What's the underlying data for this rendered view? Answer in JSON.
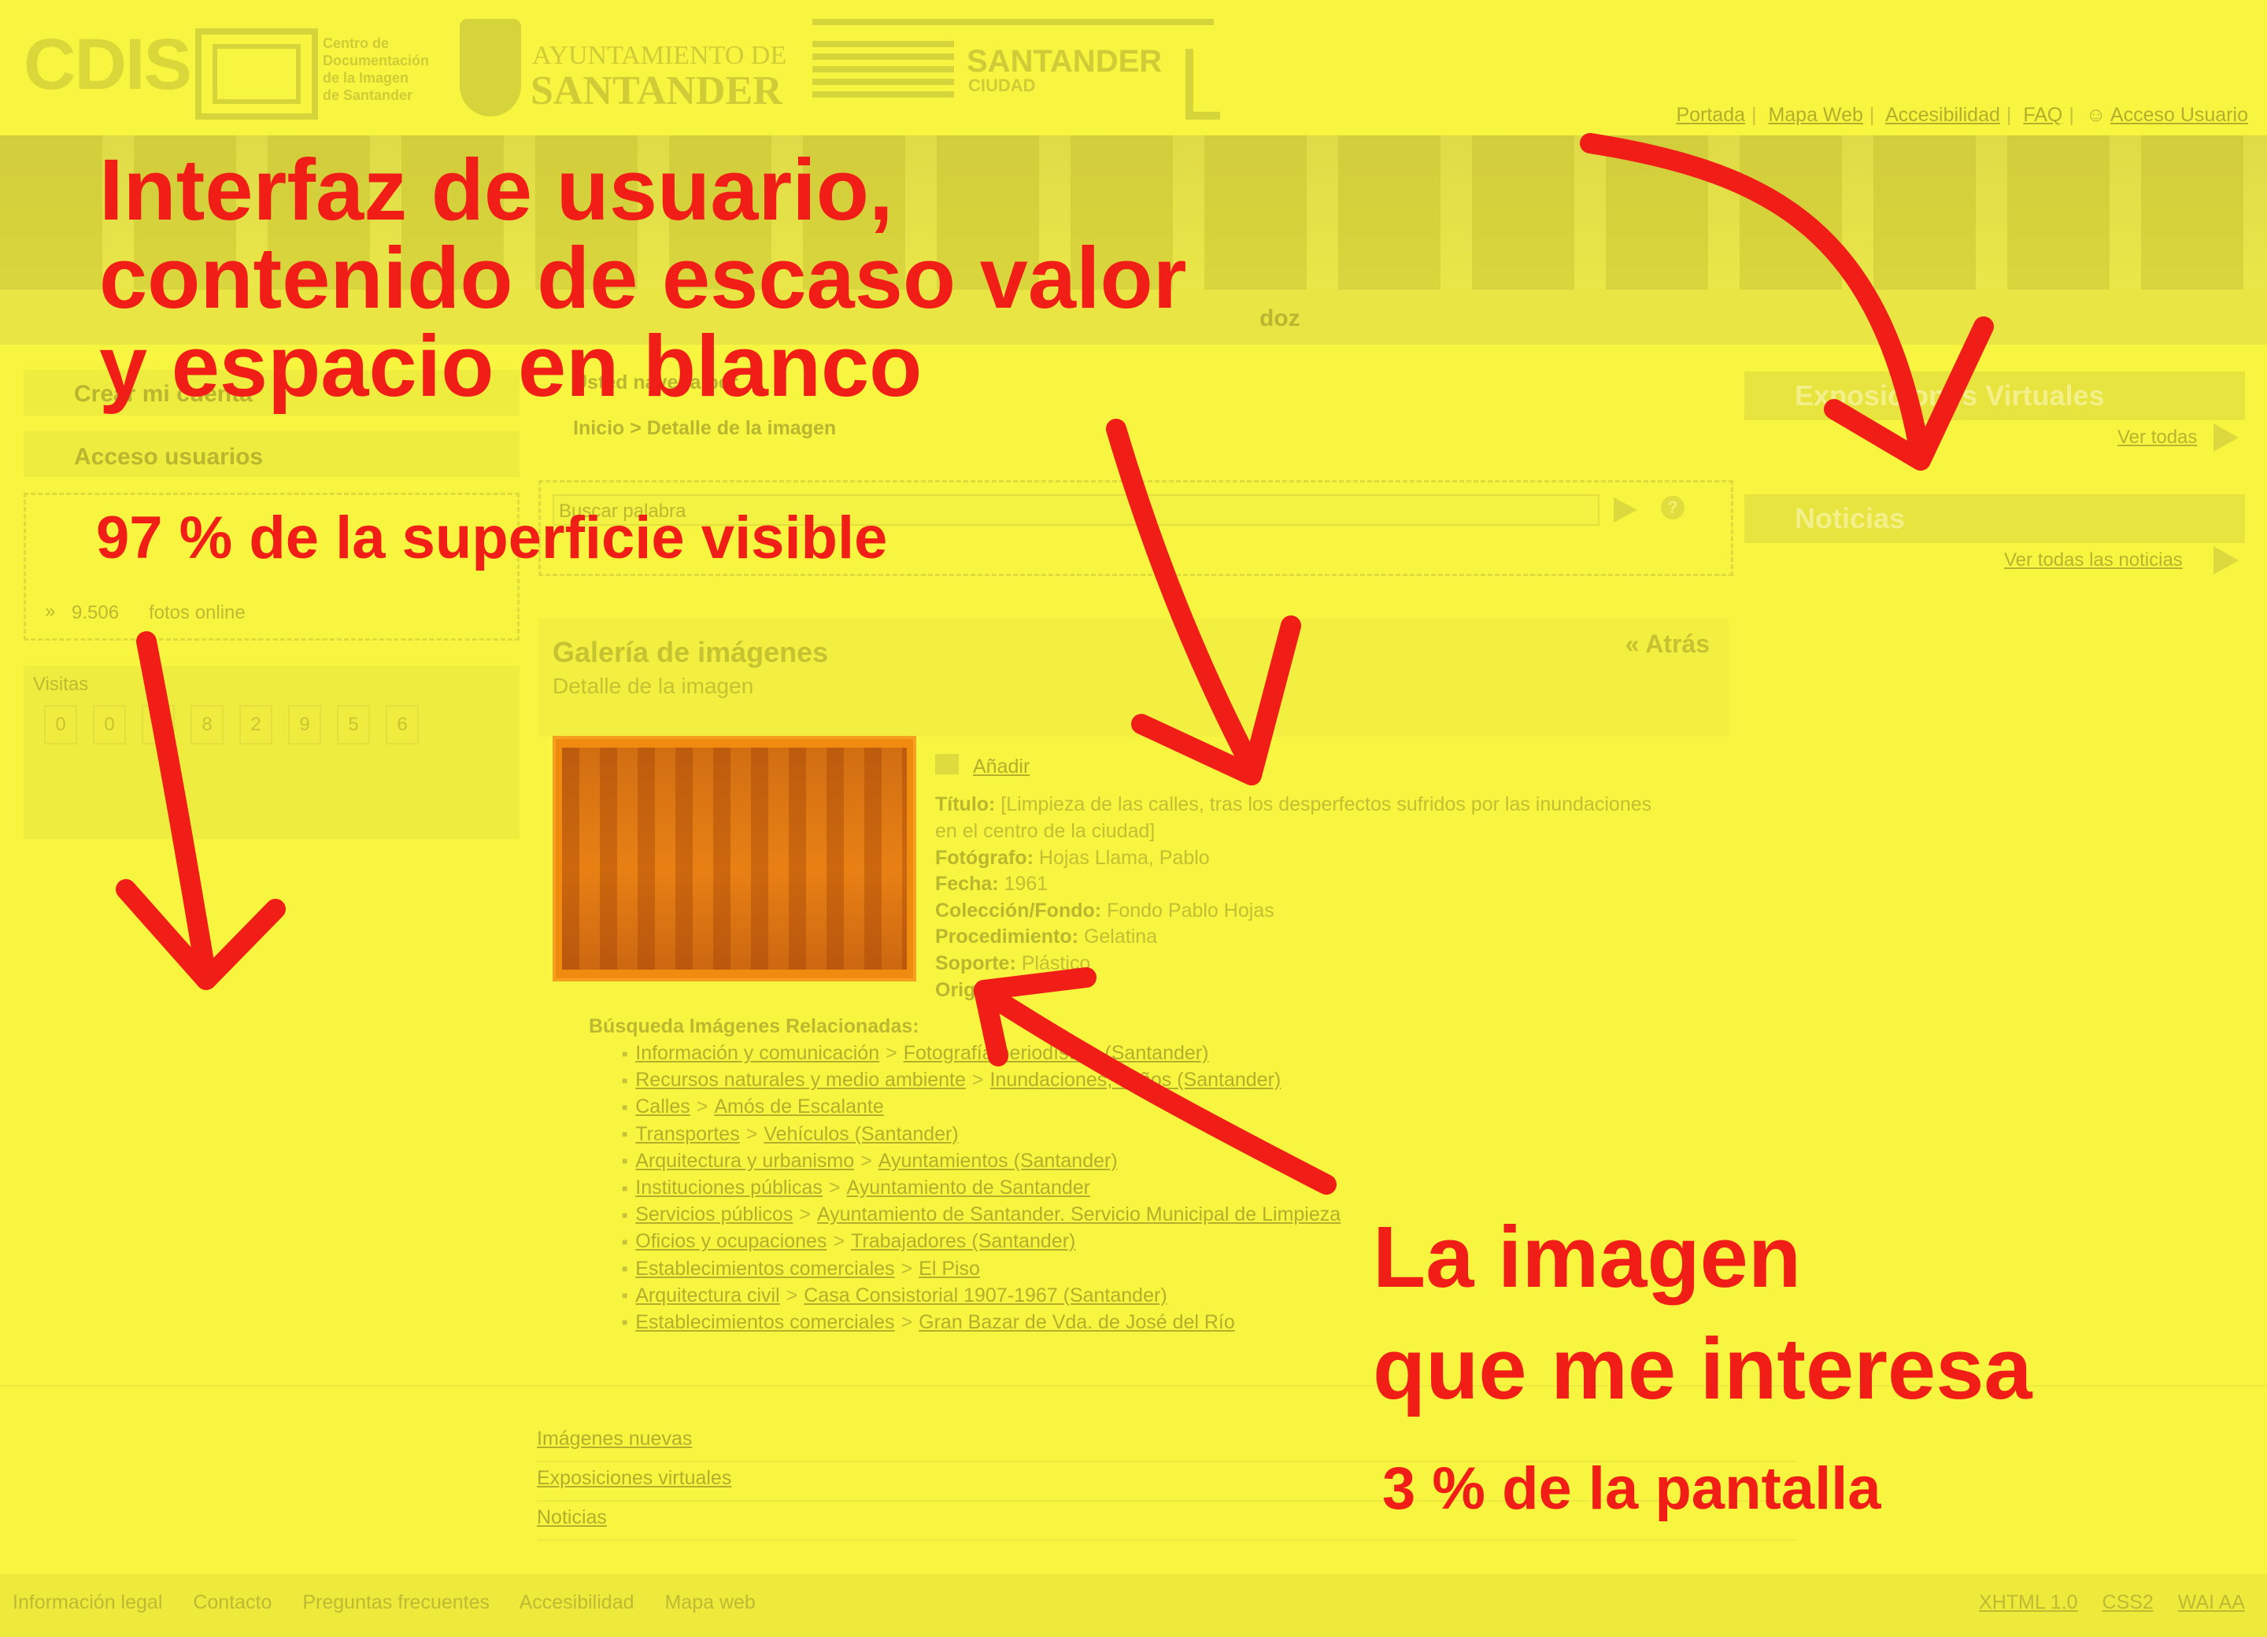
{
  "header": {
    "cdis_logo": "CDIS",
    "cdis_subtitle": [
      "Centro de",
      "Documentación",
      "de la Imagen",
      "de Santander"
    ],
    "ayto_line1": "AYUNTAMIENTO DE",
    "ayto_line2": "SANTANDER",
    "santander_title": "SANTANDER",
    "santander_sub": "CIUDAD",
    "top_links": [
      "Portada",
      "Mapa Web",
      "Accesibilidad",
      "FAQ",
      "Acceso Usuario"
    ]
  },
  "nav": {
    "fragment": "doz"
  },
  "left": {
    "create_account": "Crear mi cuenta",
    "user_access": "Acceso usuarios",
    "photos_count": "9.506",
    "photos_label": "fotos online",
    "visits_label": "Visitas",
    "visit_digits": [
      "0",
      "0",
      "6",
      "8",
      "2",
      "9",
      "5",
      "6"
    ]
  },
  "center": {
    "breadcrumb_title": "Usted navega por",
    "breadcrumb_path": "Inicio > Detalle de la imagen",
    "search_placeholder": "Buscar palabra",
    "search_help": "?",
    "gallery_title": "Galería de imágenes",
    "gallery_subtitle": "Detalle de la imagen",
    "back": "« Atrás",
    "add": "Añadir",
    "meta": [
      {
        "label": "Título:",
        "value": "[Limpieza de las calles, tras los desperfectos sufridos por las inundaciones"
      },
      {
        "label": "",
        "value": "en el centro de la ciudad]"
      },
      {
        "label": "Fotógrafo:",
        "value": "Hojas Llama, Pablo"
      },
      {
        "label": "Fecha:",
        "value": "1961"
      },
      {
        "label": "Colección/Fondo:",
        "value": "Fondo Pablo Hojas"
      },
      {
        "label": "Procedimiento:",
        "value": "Gelatina"
      },
      {
        "label": "Soporte:",
        "value": "Plástico"
      },
      {
        "label": "Orig",
        "value": ""
      }
    ],
    "related_title": "Búsqueda Imágenes Relacionadas:",
    "related": [
      [
        "Información y comunicación",
        "Fotografía periodística (Santander)"
      ],
      [
        "Recursos naturales y medio ambiente",
        "Inundaciones, daños (Santander)"
      ],
      [
        "Calles",
        "Amós de Escalante"
      ],
      [
        "Transportes",
        "Vehículos (Santander)"
      ],
      [
        "Arquitectura y urbanismo",
        "Ayuntamientos (Santander)"
      ],
      [
        "Instituciones públicas",
        "Ayuntamiento de Santander"
      ],
      [
        "Servicios públicos",
        "Ayuntamiento de Santander. Servicio Municipal de Limpieza"
      ],
      [
        "Oficios y ocupaciones",
        "Trabajadores (Santander)"
      ],
      [
        "Establecimientos comerciales",
        "El Piso"
      ],
      [
        "Arquitectura civil",
        "Casa Consistorial 1907-1967 (Santander)"
      ],
      [
        "Establecimientos comerciales",
        "Gran Bazar de Vda. de José del Río"
      ]
    ]
  },
  "right": {
    "exhibitions": "Exposiciones Virtuales",
    "see_all": "Ver todas",
    "news": "Noticias",
    "see_all_news": "Ver todas las noticias"
  },
  "footer": {
    "links": [
      "Imágenes nuevas",
      "Exposiciones virtuales",
      "Noticias"
    ],
    "bottom": [
      "Información legal",
      "Contacto",
      "Preguntas frecuentes",
      "Accesibilidad",
      "Mapa web"
    ],
    "validators": [
      "XHTML 1.0",
      "CSS2",
      "WAI AA"
    ]
  },
  "annotations": {
    "main_line1": "Interfaz de usuario,",
    "main_line2": "contenido de escaso valor",
    "main_line3": "y espacio en blanco",
    "main_pct": "97 % de la superficie visible",
    "img_line1": "La imagen",
    "img_line2": "que me interesa",
    "img_pct": "3 % de la pantalla"
  },
  "colors": {
    "overlay_yellow": "#f7f53f",
    "annotation_red": "#f11d17",
    "photo_orange": "#f08b0f"
  }
}
